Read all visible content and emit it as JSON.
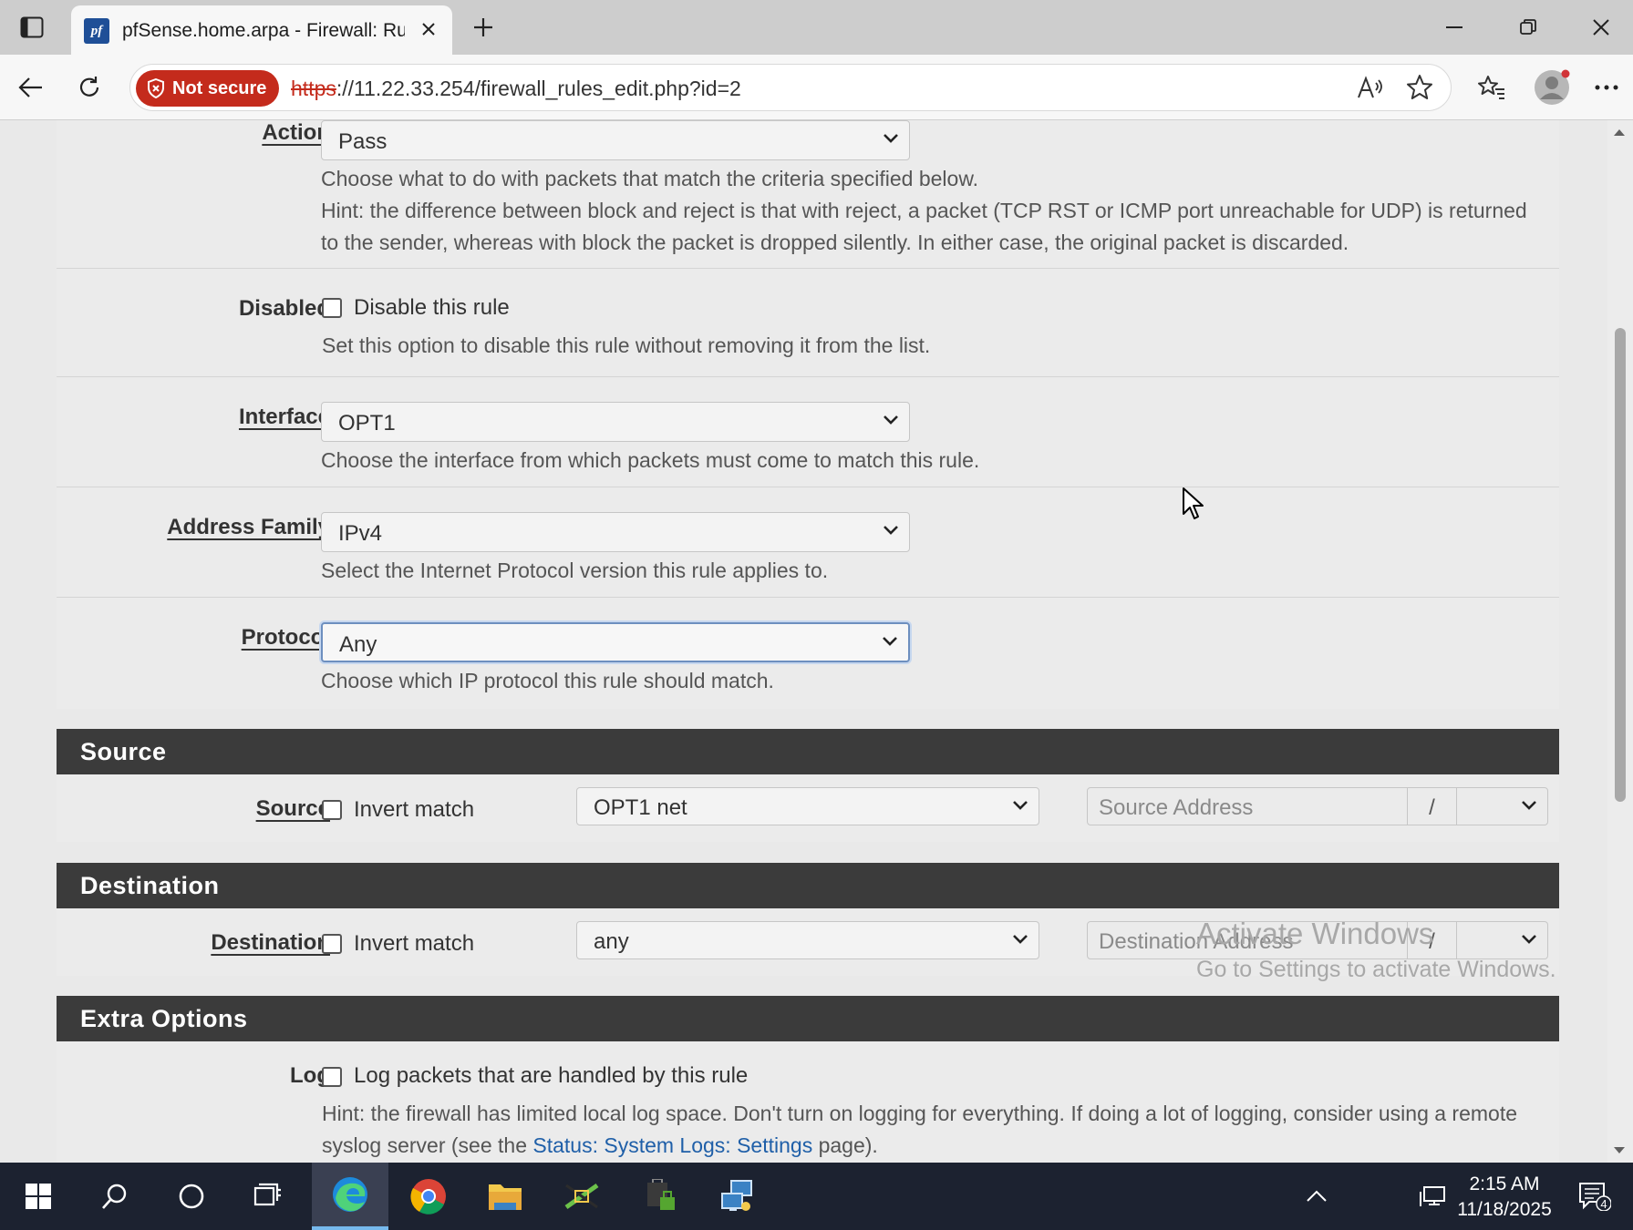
{
  "browser": {
    "tab_title": "pfSense.home.arpa - Firewall: Rules: Edit",
    "favicon_text": "pf",
    "security_badge": "Not secure",
    "url_scheme": "https",
    "url_rest": "://11.22.33.254/firewall_rules_edit.php?id=2"
  },
  "rows": {
    "action": {
      "label": "Action",
      "value": "Pass",
      "help1": "Choose what to do with packets that match the criteria specified below.",
      "help2": "Hint: the difference between block and reject is that with reject, a packet (TCP RST or ICMP port unreachable for UDP) is returned to the sender, whereas with block the packet is dropped silently. In either case, the original packet is discarded."
    },
    "disabled": {
      "label": "Disabled",
      "checkbox_label": "Disable this rule",
      "checked": false,
      "help": "Set this option to disable this rule without removing it from the list."
    },
    "interface": {
      "label": "Interface",
      "value": "OPT1",
      "help": "Choose the interface from which packets must come to match this rule."
    },
    "address_family": {
      "label": "Address Family",
      "value": "IPv4",
      "help": "Select the Internet Protocol version this rule applies to."
    },
    "protocol": {
      "label": "Protocol",
      "value": "Any",
      "help": "Choose which IP protocol this rule should match."
    }
  },
  "source": {
    "header": "Source",
    "label": "Source",
    "invert_label": "Invert match",
    "type_value": "OPT1 net",
    "address_placeholder": "Source Address",
    "slash": "/"
  },
  "destination": {
    "header": "Destination",
    "label": "Destination",
    "invert_label": "Invert match",
    "type_value": "any",
    "address_placeholder": "Destination Address",
    "slash": "/"
  },
  "extra": {
    "header": "Extra Options",
    "log_label": "Log",
    "log_checkbox_label": "Log packets that are handled by this rule",
    "log_help_prefix": "Hint: the firewall has limited local log space. Don't turn on logging for everything. If doing a lot of logging, consider using a remote syslog server (see the ",
    "log_help_link": "Status: System Logs: Settings",
    "log_help_suffix": " page)."
  },
  "watermark": {
    "title": "Activate Windows",
    "subtitle": "Go to Settings to activate Windows."
  },
  "taskbar": {
    "time": "2:15 AM",
    "date": "11/18/2025",
    "notification_count": "4"
  },
  "colors": {
    "section_header": "#3b3b3b",
    "link": "#1f5fa8",
    "not_secure": "#c42b1c",
    "taskbar": "#1c2230"
  }
}
